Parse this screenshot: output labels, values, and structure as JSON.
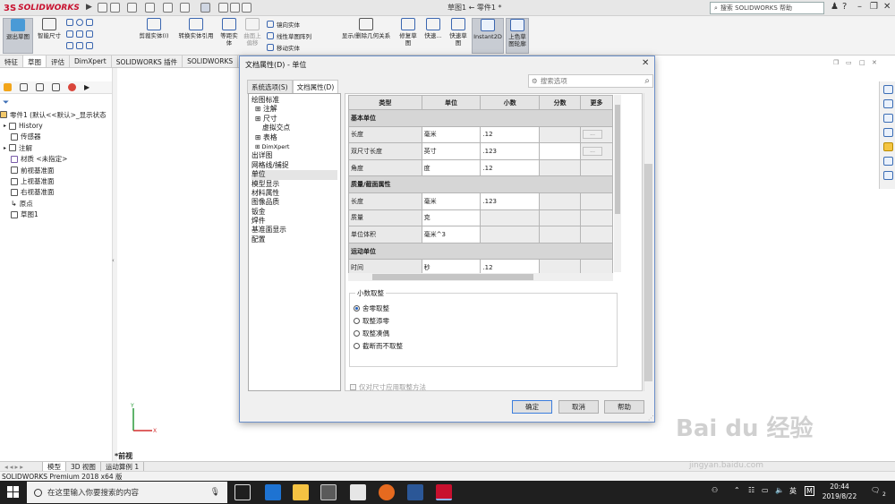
{
  "app": {
    "logo_ds": "3S",
    "logo_name": "SOLIDWORKS",
    "doc_title": "草图1 ← 零件1 *",
    "help_search_placeholder": "搜索 SOLIDWORKS 帮助"
  },
  "ribbon": {
    "exit_sketch": "退出草图",
    "smart_dim": "智能尺寸",
    "trim": "剪裁实体(I)",
    "convert": "转换实体引用",
    "offset": "等距实\n体",
    "surface": "曲面上\n偏移",
    "mirror": "镜向实体",
    "linear_pattern": "线性草图阵列",
    "move": "移动实体",
    "relations": "显示/删除几何关系",
    "repair": "修复草\n图",
    "quick_snap": "快速...",
    "rapid_sketch": "快速草\n图",
    "instant2d": "Instant2D",
    "shaded_contours": "上色草\n图轮廓"
  },
  "tabs": [
    "特征",
    "草图",
    "评估",
    "DimXpert",
    "SOLIDWORKS 插件",
    "SOLIDWORKS"
  ],
  "active_tab": 1,
  "tree": [
    "零件1 (默认<<默认>_显示状态",
    "History",
    "传感器",
    "注解",
    "材质 <未指定>",
    "前视基准面",
    "上视基准面",
    "右视基准面",
    "原点",
    "草图1"
  ],
  "view_label": "*前视",
  "model_tabs": [
    "模型",
    "3D 视图",
    "运动算例 1"
  ],
  "status_text": "SOLIDWORKS Premium 2018 x64 版",
  "taskbar": {
    "search_placeholder": "在这里输入你要搜索的内容",
    "lang": "英",
    "ime": "M",
    "time": "20:44",
    "date": "2019/8/22",
    "notif": "2"
  },
  "dialog": {
    "title": "文档属性(D) - 单位",
    "close": "✕",
    "tabs": [
      "系统选项(S)",
      "文档属性(D)"
    ],
    "active_tab": 1,
    "search_placeholder": "搜索选项",
    "tree": [
      "绘图标准",
      "注解",
      "尺寸",
      "虚拟交点",
      "表格",
      "DimXpert",
      "出详图",
      "网格线/捕捉",
      "单位",
      "模型显示",
      "材料属性",
      "图像品质",
      "钣金",
      "焊件",
      "基准面显示",
      "配置"
    ],
    "grid": {
      "headers": [
        "类型",
        "单位",
        "小数",
        "分数",
        "更多"
      ],
      "rows": [
        {
          "section": "基本单位"
        },
        {
          "type": "长度",
          "unit": "毫米",
          "decimals": ".12",
          "more": "..."
        },
        {
          "type": "双尺寸长度",
          "unit": "英寸",
          "decimals": ".123",
          "more": "..."
        },
        {
          "type": "角度",
          "unit": "度",
          "decimals": ".12"
        },
        {
          "section": "质量/截面属性"
        },
        {
          "type": "长度",
          "unit": "毫米",
          "decimals": ".123"
        },
        {
          "type": "质量",
          "unit": "克",
          "decimals": ""
        },
        {
          "type": "单位体积",
          "unit": "毫米^3",
          "decimals": ""
        },
        {
          "section": "运动单位"
        },
        {
          "type": "时间",
          "unit": "秒",
          "decimals": ".12"
        }
      ]
    },
    "rounding_title": "小数取整",
    "rounding_options": [
      "舍零取整",
      "取整添零",
      "取整凑偶",
      "截断而不取整"
    ],
    "rounding_selected": 0,
    "dim_only_check": "仅对尺寸应用取整方法",
    "buttons": {
      "ok": "确定",
      "cancel": "取消",
      "help": "帮助"
    }
  },
  "watermark": {
    "main": "Bai du 经验",
    "sub": "jingyan.baidu.com"
  }
}
